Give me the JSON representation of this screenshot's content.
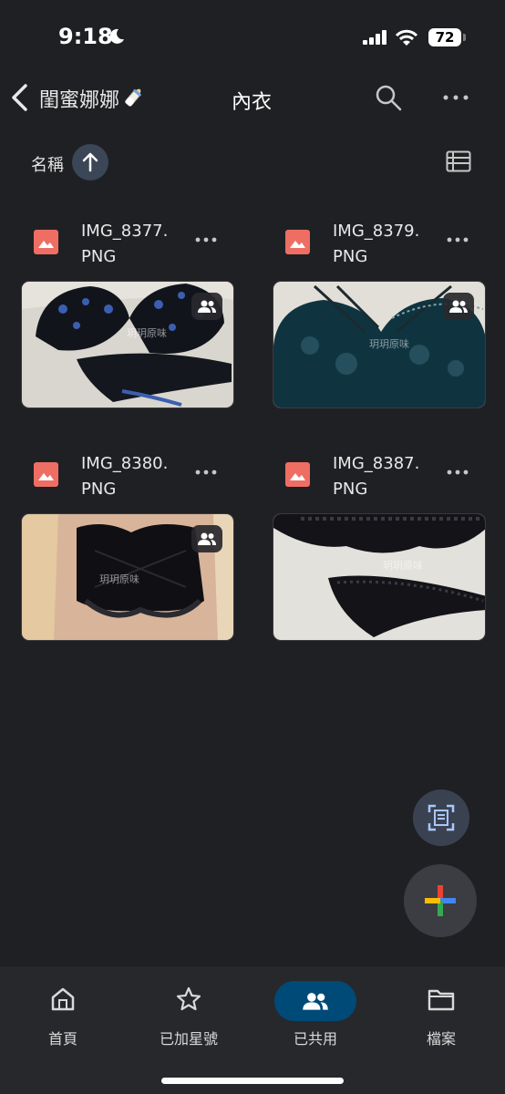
{
  "status_bar": {
    "time": "9:18",
    "battery": "72"
  },
  "header": {
    "parent_folder": "閨蜜娜娜",
    "title": "內衣"
  },
  "sort": {
    "label": "名稱"
  },
  "files": [
    {
      "name_line1": "IMG_8377.",
      "name_line2": "PNG"
    },
    {
      "name_line1": "IMG_8379.",
      "name_line2": "PNG"
    },
    {
      "name_line1": "IMG_8380.",
      "name_line2": "PNG"
    },
    {
      "name_line1": "IMG_8387.",
      "name_line2": "PNG"
    }
  ],
  "watermark": "玥玥原味",
  "bottom_nav": [
    {
      "label": "首頁",
      "icon": "home-icon"
    },
    {
      "label": "已加星號",
      "icon": "star-icon"
    },
    {
      "label": "已共用",
      "icon": "people-icon",
      "active": true
    },
    {
      "label": "檔案",
      "icon": "folder-icon"
    }
  ],
  "colors": {
    "background": "#1f2023",
    "image_file_icon": "#ee6e63",
    "active_nav": "#004a77",
    "sort_button": "#3b4656"
  }
}
